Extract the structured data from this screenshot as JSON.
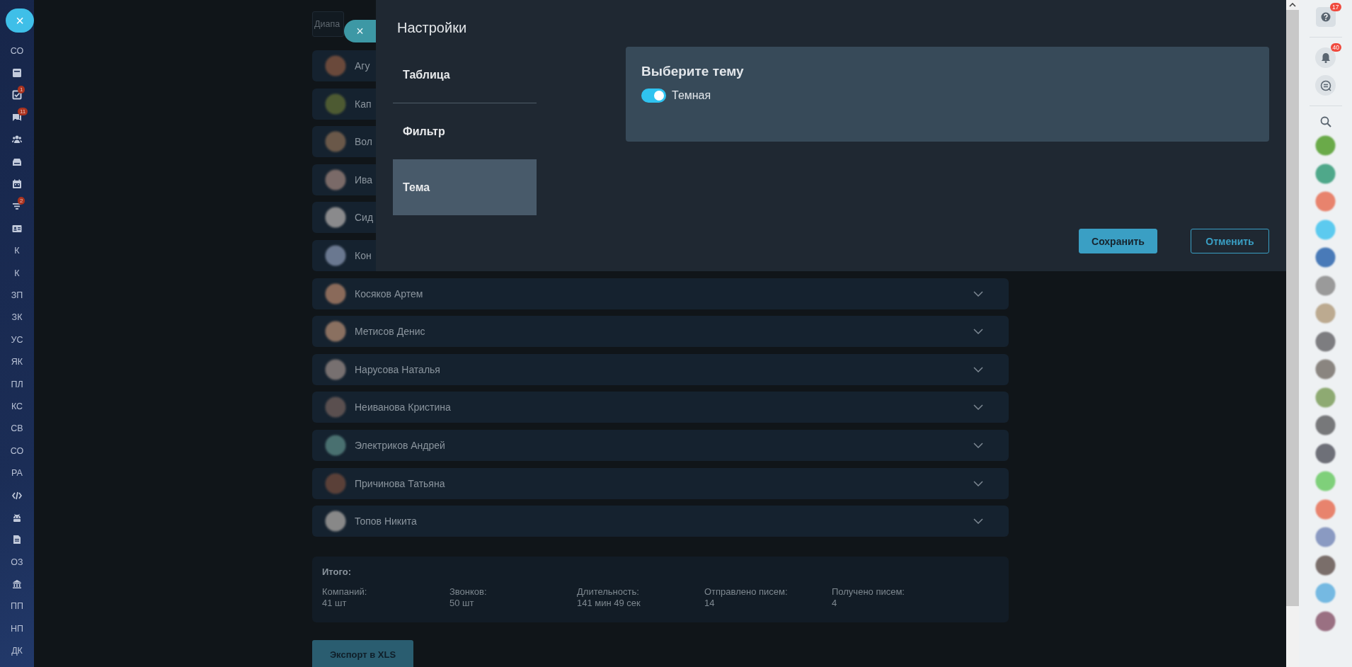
{
  "sidebar": {
    "close": "×",
    "items": [
      {
        "kind": "text",
        "label": "СО"
      },
      {
        "kind": "icon"
      },
      {
        "kind": "icon",
        "badge": "1"
      },
      {
        "kind": "icon",
        "badge": "11"
      },
      {
        "kind": "icon"
      },
      {
        "kind": "icon"
      },
      {
        "kind": "icon"
      },
      {
        "kind": "icon",
        "badge": "2"
      },
      {
        "kind": "icon"
      },
      {
        "kind": "text",
        "label": "К"
      },
      {
        "kind": "text",
        "label": "К"
      },
      {
        "kind": "text",
        "label": "ЗП"
      },
      {
        "kind": "text",
        "label": "ЗК"
      },
      {
        "kind": "text",
        "label": "УС"
      },
      {
        "kind": "text",
        "label": "ЯК"
      },
      {
        "kind": "text",
        "label": "ПЛ"
      },
      {
        "kind": "text",
        "label": "КС"
      },
      {
        "kind": "text",
        "label": "СВ"
      },
      {
        "kind": "text",
        "label": "СО"
      },
      {
        "kind": "text",
        "label": "РА"
      },
      {
        "kind": "icon"
      },
      {
        "kind": "icon"
      },
      {
        "kind": "icon"
      },
      {
        "kind": "text",
        "label": "ОЗ"
      },
      {
        "kind": "icon"
      },
      {
        "kind": "text",
        "label": "ПП"
      },
      {
        "kind": "text",
        "label": "НП"
      },
      {
        "kind": "text",
        "label": "ДК"
      }
    ]
  },
  "page": {
    "range_field": {
      "placeholder": "Диапа"
    },
    "rows": [
      {
        "name": "Агу",
        "kind": "covered"
      },
      {
        "name": "Кап",
        "kind": "covered"
      },
      {
        "name": "Вол",
        "kind": "covered"
      },
      {
        "name": "Ива",
        "kind": "covered"
      },
      {
        "name": "Сид",
        "kind": "covered"
      },
      {
        "name": "Кон",
        "kind": "covered"
      },
      {
        "name": "Косяков Артем",
        "kind": "full"
      },
      {
        "name": "Метисов Денис",
        "kind": "full"
      },
      {
        "name": "Нарусова Наталья",
        "kind": "full"
      },
      {
        "name": "Неиванова Кристина",
        "kind": "full"
      },
      {
        "name": "Электриков Андрей",
        "kind": "full"
      },
      {
        "name": "Причинова Татьяна",
        "kind": "full"
      },
      {
        "name": "Топов Никита",
        "kind": "full"
      }
    ],
    "summary": {
      "title": "Итого:",
      "stats": [
        {
          "label": "Компаний:",
          "value": "41 шт"
        },
        {
          "label": "Звонков:",
          "value": "50 шт"
        },
        {
          "label": "Длительность:",
          "value": "141 мин 49 сек"
        },
        {
          "label": "Отправлено писем:",
          "value": "14"
        },
        {
          "label": "Получено писем:",
          "value": "4"
        }
      ]
    },
    "export_button": "Экспорт в XLS"
  },
  "modal": {
    "close": "×",
    "title": "Настройки",
    "tabs": [
      {
        "label": "Таблица",
        "selected": false
      },
      {
        "label": "Фильтр",
        "selected": false
      },
      {
        "label": "Тема",
        "selected": true
      }
    ],
    "theme_card": {
      "title": "Выберите тему",
      "toggle": {
        "label": "Темная",
        "on": true
      }
    },
    "buttons": [
      {
        "label": "Сохранить",
        "kind": "primary"
      },
      {
        "label": "Отменить",
        "kind": "secondary"
      }
    ]
  },
  "right_panel": {
    "help_badge": "17",
    "notifications_badge": "40"
  }
}
